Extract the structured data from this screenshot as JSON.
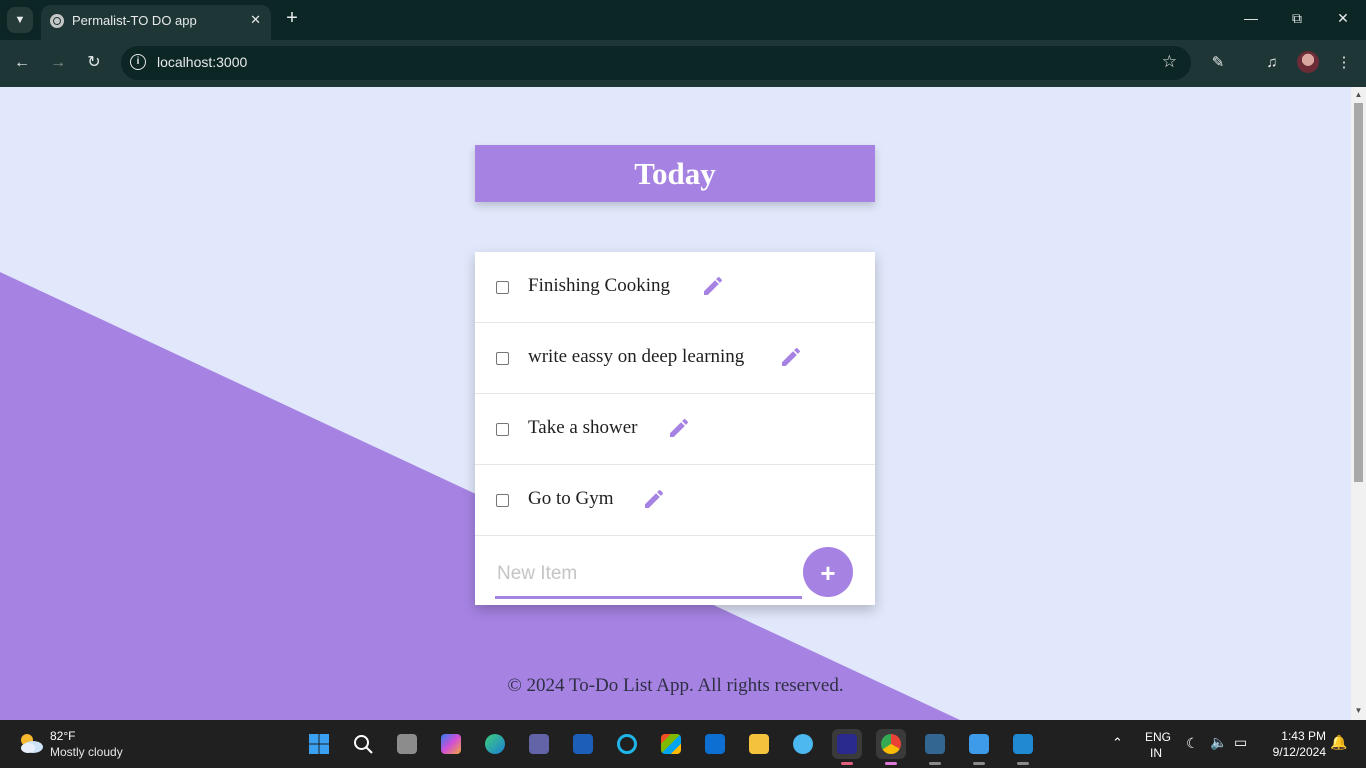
{
  "browser": {
    "tab_title": "Permalist-TO DO app",
    "url": "localhost:3000"
  },
  "app": {
    "header_title": "Today",
    "items": [
      {
        "label": "Finishing Cooking"
      },
      {
        "label": "write eassy on deep learning"
      },
      {
        "label": "Take a shower"
      },
      {
        "label": "Go to Gym"
      }
    ],
    "new_item_placeholder": "New Item",
    "add_label": "+",
    "footer": "© 2024 To-Do List App. All rights reserved.",
    "accent_color": "#a683e3",
    "background_color": "#e1e8fb"
  },
  "taskbar": {
    "weather_temp": "82°F",
    "weather_condition": "Mostly cloudy",
    "lang_primary": "ENG",
    "lang_secondary": "IN",
    "time": "1:43 PM",
    "date": "9/12/2024"
  }
}
